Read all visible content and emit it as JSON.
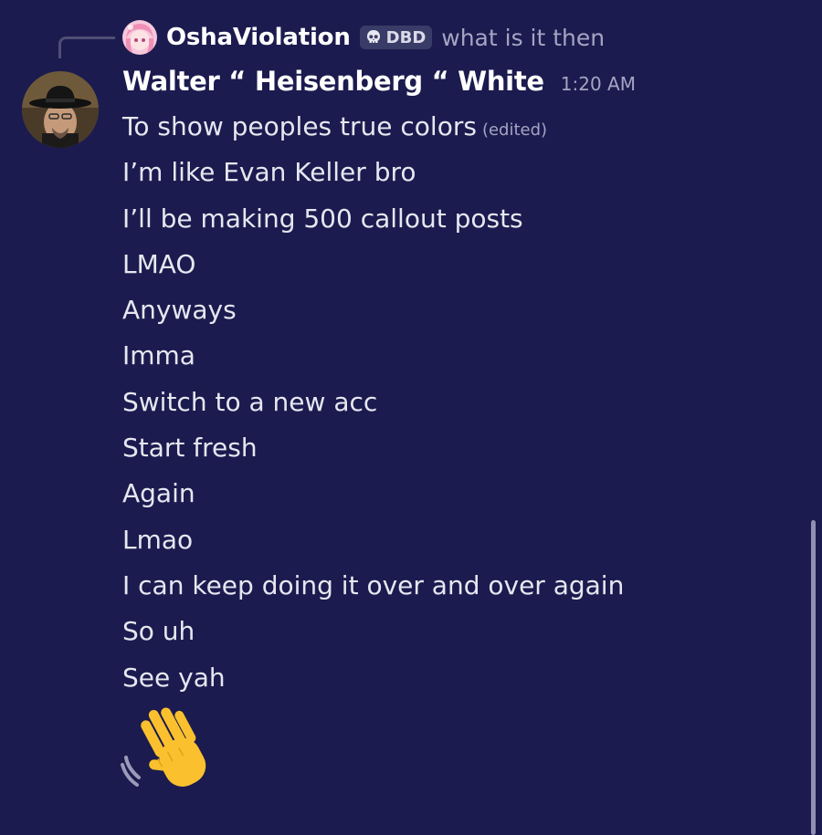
{
  "reply": {
    "author": "OshaViolation",
    "tag_icon": "skull-icon",
    "tag_label": "DBD",
    "text": "what is it then"
  },
  "message": {
    "author": "Walter “ Heisenberg “ White",
    "timestamp": "1:20 AM",
    "edited_label": "(edited)",
    "lines": [
      "To show peoples true colors",
      "I’m like Evan Keller bro",
      "I’ll be making 500 callout posts",
      "LMAO",
      "Anyways",
      "Imma",
      "Switch to a new acc",
      "Start fresh",
      "Again",
      "Lmao",
      "I can keep doing it over and over again",
      "So uh",
      "See yah"
    ],
    "emoji": "waving-hand-icon"
  },
  "colors": {
    "background": "#1b1b4f",
    "text": "#e6e7f0",
    "muted": "#a3a5c2",
    "username": "#ffffff"
  }
}
